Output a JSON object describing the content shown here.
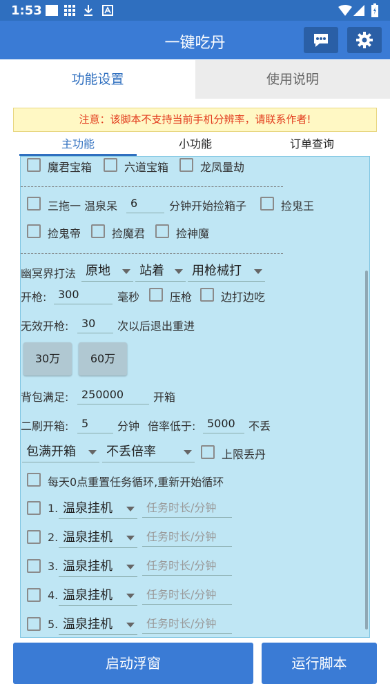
{
  "status": {
    "time": "1:53"
  },
  "appbar": {
    "title": "一键吃丹"
  },
  "tabs": {
    "main": [
      "功能设置",
      "使用说明"
    ],
    "sub": [
      "主功能",
      "小功能",
      "订单查询"
    ]
  },
  "warning": "注意：该脚本不支持当前手机分辨率，请联系作者!",
  "row1": {
    "items": [
      "魔君宝箱",
      "六道宝箱",
      "龙凤量劫"
    ]
  },
  "row2": {
    "label": "三拖一 温泉呆",
    "minutes": "6",
    "suffix": "分钟开始捡箱子",
    "item": "捡鬼王"
  },
  "row3": {
    "items": [
      "捡鬼帝",
      "捡魔君",
      "捡神魔"
    ]
  },
  "ghost": {
    "label": "幽冥界打法",
    "sel1": "原地",
    "sel2": "站着",
    "sel3": "用枪械打"
  },
  "fire": {
    "label": "开枪:",
    "value": "300",
    "unit": "毫秒",
    "cb1": "压枪",
    "cb2": "边打边吃"
  },
  "invalid": {
    "label": "无效开枪:",
    "value": "30",
    "suffix": "次以后退出重进"
  },
  "buttons": [
    "30万",
    "60万"
  ],
  "bag": {
    "label": "背包满足:",
    "value": "250000",
    "suffix": "开箱"
  },
  "refresh": {
    "label": "二刷开箱:",
    "value": "5",
    "unit": "分钟",
    "rate_label": "倍率低于:",
    "rate": "5000",
    "rate_suffix": "不丢"
  },
  "mode": {
    "sel1": "包满开箱",
    "sel2": "不丢倍率",
    "cb": "上限丢丹"
  },
  "daily": "每天0点重置任务循环,重新开始循环",
  "tasks": [
    {
      "num": "1.",
      "sel": "温泉挂机",
      "placeholder": "任务时长/分钟"
    },
    {
      "num": "2.",
      "sel": "温泉挂机",
      "placeholder": "任务时长/分钟"
    },
    {
      "num": "3.",
      "sel": "温泉挂机",
      "placeholder": "任务时长/分钟"
    },
    {
      "num": "4.",
      "sel": "温泉挂机",
      "placeholder": "任务时长/分钟"
    },
    {
      "num": "5.",
      "sel": "温泉挂机",
      "placeholder": "任务时长/分钟"
    }
  ],
  "bottom": {
    "float": "启动浮窗",
    "run": "运行脚本"
  }
}
